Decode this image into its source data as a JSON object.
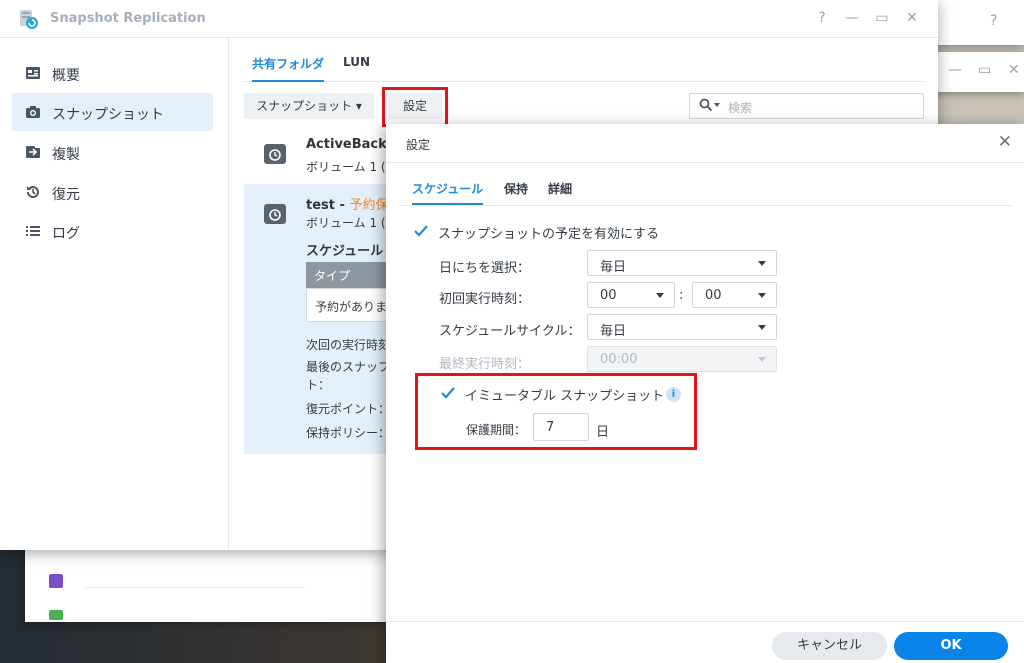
{
  "app": {
    "title": "Snapshot Replication"
  },
  "window_controls": {
    "help": "?",
    "minimize": "—",
    "maximize": "▭",
    "close": "✕"
  },
  "sidebar": {
    "items": [
      {
        "label": "概要",
        "icon": "overview-icon"
      },
      {
        "label": "スナップショット",
        "icon": "camera-icon",
        "active": true
      },
      {
        "label": "複製",
        "icon": "replication-icon"
      },
      {
        "label": "復元",
        "icon": "restore-icon"
      },
      {
        "label": "ログ",
        "icon": "log-icon"
      }
    ]
  },
  "main": {
    "tabs": [
      {
        "label": "共有フォルダ",
        "active": true
      },
      {
        "label": "LUN"
      }
    ],
    "toolbar": {
      "snapshot_label": "スナップショット ▾",
      "settings_label": "設定"
    },
    "search": {
      "placeholder": "検索"
    },
    "list": [
      {
        "title": "ActiveBacku",
        "sub": "ボリューム 1 ("
      },
      {
        "title": "test",
        "title_tag": "予約保護",
        "sub": "ボリューム 1 (",
        "selected": true,
        "schedule_heading": "スケジュール",
        "table_header": "タイプ",
        "table_cell": "予約がありま",
        "details": [
          "次回の実行時刻",
          "最後のスナップ",
          "ト：",
          "復元ポイント：",
          "保持ポリシー："
        ]
      }
    ]
  },
  "dialog": {
    "title": "設定",
    "close": "✕",
    "tabs": [
      {
        "label": "スケジュール",
        "active": true
      },
      {
        "label": "保持"
      },
      {
        "label": "詳細"
      }
    ],
    "enable_schedule": {
      "label": "スナップショットの予定を有効にする",
      "checked": true
    },
    "fields": {
      "date_label": "日にちを選択：",
      "date_value": "毎日",
      "first_run_label": "初回実行時刻：",
      "hour_value": "00",
      "separator": ":",
      "minute_value": "00",
      "cycle_label": "スケジュールサイクル：",
      "cycle_value": "毎日",
      "last_run_label": "最終実行時刻：",
      "last_run_value": "00:00"
    },
    "immutable": {
      "label": "イミュータブル スナップショット",
      "checked": true,
      "info": "i",
      "period_label": "保護期間：",
      "period_value": "7",
      "period_unit": "日"
    },
    "buttons": {
      "cancel": "キャンセル",
      "ok": "OK"
    }
  },
  "colors": {
    "accent": "#1f8ad8",
    "highlight": "#e2141c",
    "ok_button": "#0a84e8"
  }
}
